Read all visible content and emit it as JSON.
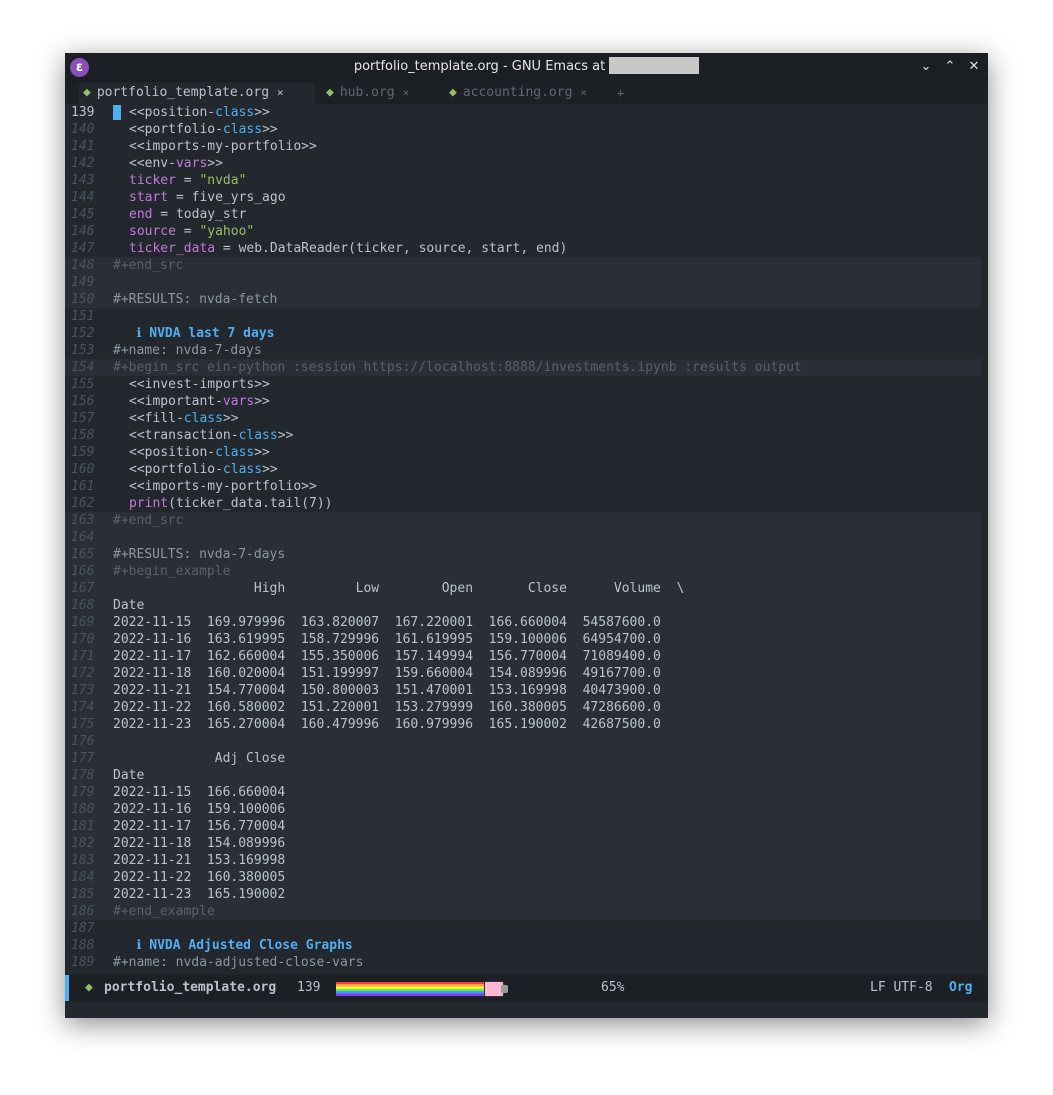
{
  "window": {
    "title": "portfolio_template.org - GNU Emacs at",
    "app_icon": "emacs-icon"
  },
  "tabs": [
    {
      "label": "portfolio_template.org",
      "close": "×",
      "active": true
    },
    {
      "label": "hub.org",
      "close": "×",
      "active": false
    },
    {
      "label": "accounting.org",
      "close": "×",
      "active": false
    }
  ],
  "new_tab_label": "+",
  "colors": {
    "background": "#23272e",
    "keyword": "#51afef",
    "variable": "#c678dd",
    "string": "#98be65",
    "comment": "#5b6268",
    "text": "#bbc2cf"
  },
  "lines": [
    {
      "n": "139",
      "current": true,
      "block": false,
      "segs": [
        [
          "text",
          "<<position-"
        ],
        [
          "keyword",
          "class"
        ],
        [
          "text",
          ">>"
        ]
      ]
    },
    {
      "n": "140",
      "block": false,
      "segs": [
        [
          "text",
          "<<portfolio-"
        ],
        [
          "keyword",
          "class"
        ],
        [
          "text",
          ">>"
        ]
      ]
    },
    {
      "n": "141",
      "block": false,
      "segs": [
        [
          "text",
          "<<imports-my-portfolio>>"
        ]
      ]
    },
    {
      "n": "142",
      "block": false,
      "segs": [
        [
          "text",
          "<<env-"
        ],
        [
          "var",
          "vars"
        ],
        [
          "text",
          ">>"
        ]
      ]
    },
    {
      "n": "143",
      "block": false,
      "segs": [
        [
          "var",
          "ticker"
        ],
        [
          "text",
          " = "
        ],
        [
          "string",
          "\"nvda\""
        ]
      ]
    },
    {
      "n": "144",
      "block": false,
      "segs": [
        [
          "var",
          "start"
        ],
        [
          "text",
          " = five_yrs_ago"
        ]
      ]
    },
    {
      "n": "145",
      "block": false,
      "segs": [
        [
          "var",
          "end"
        ],
        [
          "text",
          " = today_str"
        ]
      ]
    },
    {
      "n": "146",
      "block": false,
      "segs": [
        [
          "var",
          "source"
        ],
        [
          "text",
          " = "
        ],
        [
          "string",
          "\"yahoo\""
        ]
      ]
    },
    {
      "n": "147",
      "block": false,
      "segs": [
        [
          "var",
          "ticker_data"
        ],
        [
          "text",
          " = web.DataReader(ticker, source, start, end)"
        ]
      ]
    },
    {
      "n": "148",
      "block": true,
      "segs": [
        [
          "meta",
          "#+end_src"
        ]
      ]
    },
    {
      "n": "149",
      "block": true,
      "segs": []
    },
    {
      "n": "150",
      "block": true,
      "segs": [
        [
          "dim",
          "#+RESULTS: nvda-fetch"
        ]
      ]
    },
    {
      "n": "151",
      "block": false,
      "segs": []
    },
    {
      "n": "152",
      "block": false,
      "segs": [
        [
          "bullet",
          "   ℹ "
        ],
        [
          "heading",
          "NVDA last 7 days"
        ]
      ]
    },
    {
      "n": "153",
      "block": false,
      "segs": [
        [
          "dim",
          "#+name: nvda-7-days"
        ]
      ]
    },
    {
      "n": "154",
      "block": true,
      "segs": [
        [
          "meta",
          "#+begin_src ein-python :session https://localhost:8888/investments.ipynb :results output"
        ]
      ]
    },
    {
      "n": "155",
      "block": false,
      "segs": [
        [
          "text",
          "<<invest-imports>>"
        ]
      ]
    },
    {
      "n": "156",
      "block": false,
      "segs": [
        [
          "text",
          "<<important-"
        ],
        [
          "var",
          "vars"
        ],
        [
          "text",
          ">>"
        ]
      ]
    },
    {
      "n": "157",
      "block": false,
      "segs": [
        [
          "text",
          "<<fill-"
        ],
        [
          "keyword",
          "class"
        ],
        [
          "text",
          ">>"
        ]
      ]
    },
    {
      "n": "158",
      "block": false,
      "segs": [
        [
          "text",
          "<<transaction-"
        ],
        [
          "keyword",
          "class"
        ],
        [
          "text",
          ">>"
        ]
      ]
    },
    {
      "n": "159",
      "block": false,
      "segs": [
        [
          "text",
          "<<position-"
        ],
        [
          "keyword",
          "class"
        ],
        [
          "text",
          ">>"
        ]
      ]
    },
    {
      "n": "160",
      "block": false,
      "segs": [
        [
          "text",
          "<<portfolio-"
        ],
        [
          "keyword",
          "class"
        ],
        [
          "text",
          ">>"
        ]
      ]
    },
    {
      "n": "161",
      "block": false,
      "segs": [
        [
          "text",
          "<<imports-my-portfolio>>"
        ]
      ]
    },
    {
      "n": "162",
      "block": false,
      "segs": [
        [
          "var",
          "print"
        ],
        [
          "text",
          "(ticker_data.tail(7))"
        ]
      ]
    },
    {
      "n": "163",
      "block": true,
      "segs": [
        [
          "meta",
          "#+end_src"
        ]
      ]
    },
    {
      "n": "164",
      "block": true,
      "segs": []
    },
    {
      "n": "165",
      "block": true,
      "segs": [
        [
          "dim",
          "#+RESULTS: nvda-7-days"
        ]
      ]
    },
    {
      "n": "166",
      "block": true,
      "segs": [
        [
          "meta",
          "#+begin_example"
        ]
      ]
    },
    {
      "n": "167",
      "block": true,
      "segs": [
        [
          "text",
          "                  High         Low        Open       Close      Volume  \\"
        ]
      ]
    },
    {
      "n": "168",
      "block": true,
      "segs": [
        [
          "text",
          "Date"
        ]
      ]
    },
    {
      "n": "169",
      "block": true,
      "segs": [
        [
          "text",
          "2022-11-15  169.979996  163.820007  167.220001  166.660004  54587600.0"
        ]
      ]
    },
    {
      "n": "170",
      "block": true,
      "segs": [
        [
          "text",
          "2022-11-16  163.619995  158.729996  161.619995  159.100006  64954700.0"
        ]
      ]
    },
    {
      "n": "171",
      "block": true,
      "segs": [
        [
          "text",
          "2022-11-17  162.660004  155.350006  157.149994  156.770004  71089400.0"
        ]
      ]
    },
    {
      "n": "172",
      "block": true,
      "segs": [
        [
          "text",
          "2022-11-18  160.020004  151.199997  159.660004  154.089996  49167700.0"
        ]
      ]
    },
    {
      "n": "173",
      "block": true,
      "segs": [
        [
          "text",
          "2022-11-21  154.770004  150.800003  151.470001  153.169998  40473900.0"
        ]
      ]
    },
    {
      "n": "174",
      "block": true,
      "segs": [
        [
          "text",
          "2022-11-22  160.580002  151.220001  153.279999  160.380005  47286600.0"
        ]
      ]
    },
    {
      "n": "175",
      "block": true,
      "segs": [
        [
          "text",
          "2022-11-23  165.270004  160.479996  160.979996  165.190002  42687500.0"
        ]
      ]
    },
    {
      "n": "176",
      "block": true,
      "segs": []
    },
    {
      "n": "177",
      "block": true,
      "segs": [
        [
          "text",
          "             Adj Close"
        ]
      ]
    },
    {
      "n": "178",
      "block": true,
      "segs": [
        [
          "text",
          "Date"
        ]
      ]
    },
    {
      "n": "179",
      "block": true,
      "segs": [
        [
          "text",
          "2022-11-15  166.660004"
        ]
      ]
    },
    {
      "n": "180",
      "block": true,
      "segs": [
        [
          "text",
          "2022-11-16  159.100006"
        ]
      ]
    },
    {
      "n": "181",
      "block": true,
      "segs": [
        [
          "text",
          "2022-11-17  156.770004"
        ]
      ]
    },
    {
      "n": "182",
      "block": true,
      "segs": [
        [
          "text",
          "2022-11-18  154.089996"
        ]
      ]
    },
    {
      "n": "183",
      "block": true,
      "segs": [
        [
          "text",
          "2022-11-21  153.169998"
        ]
      ]
    },
    {
      "n": "184",
      "block": true,
      "segs": [
        [
          "text",
          "2022-11-22  160.380005"
        ]
      ]
    },
    {
      "n": "185",
      "block": true,
      "segs": [
        [
          "text",
          "2022-11-23  165.190002"
        ]
      ]
    },
    {
      "n": "186",
      "block": true,
      "segs": [
        [
          "meta",
          "#+end_example"
        ]
      ]
    },
    {
      "n": "187",
      "block": false,
      "segs": []
    },
    {
      "n": "188",
      "block": false,
      "segs": [
        [
          "bullet",
          "   ℹ "
        ],
        [
          "heading",
          "NVDA Adjusted Close Graphs"
        ]
      ]
    },
    {
      "n": "189",
      "block": false,
      "segs": [
        [
          "dim",
          "#+name: nvda-adjusted-close-vars"
        ]
      ]
    }
  ],
  "modeline": {
    "filename": "portfolio_template.org",
    "line": "139",
    "percent": "65%",
    "encoding": "LF UTF-8",
    "mode": "Org",
    "scroll_fraction": 0.65
  }
}
